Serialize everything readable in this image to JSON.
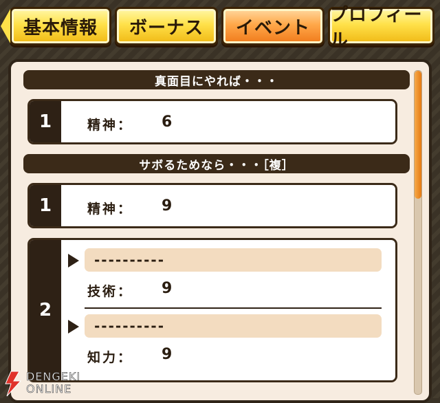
{
  "tabs": [
    {
      "label": "基本情報",
      "active": false
    },
    {
      "label": "ボーナス",
      "active": false
    },
    {
      "label": "イベント",
      "active": true
    },
    {
      "label": "プロフィール",
      "active": false
    }
  ],
  "sections": [
    {
      "title": "真面目にやれば・・・",
      "entries": [
        {
          "num": "1",
          "stat": "精神：",
          "value": "6"
        }
      ]
    },
    {
      "title": "サボるためなら・・・［複］",
      "entries": [
        {
          "num": "1",
          "stat": "精神：",
          "value": "9"
        },
        {
          "num": "2",
          "choices": [
            {
              "label": "----------",
              "stat": "技術：",
              "value": "9"
            },
            {
              "label": "----------",
              "stat": "知力：",
              "value": "9"
            }
          ]
        }
      ]
    }
  ],
  "watermark": {
    "line1": "DENGEKI",
    "line2": "ONLINE"
  },
  "colors": {
    "tab_yellow": "#ffe14a",
    "tab_active": "#f07a1a",
    "header": "#3b2a18",
    "panel_bg": "#f7ece0",
    "scroll": "#e57a12"
  }
}
